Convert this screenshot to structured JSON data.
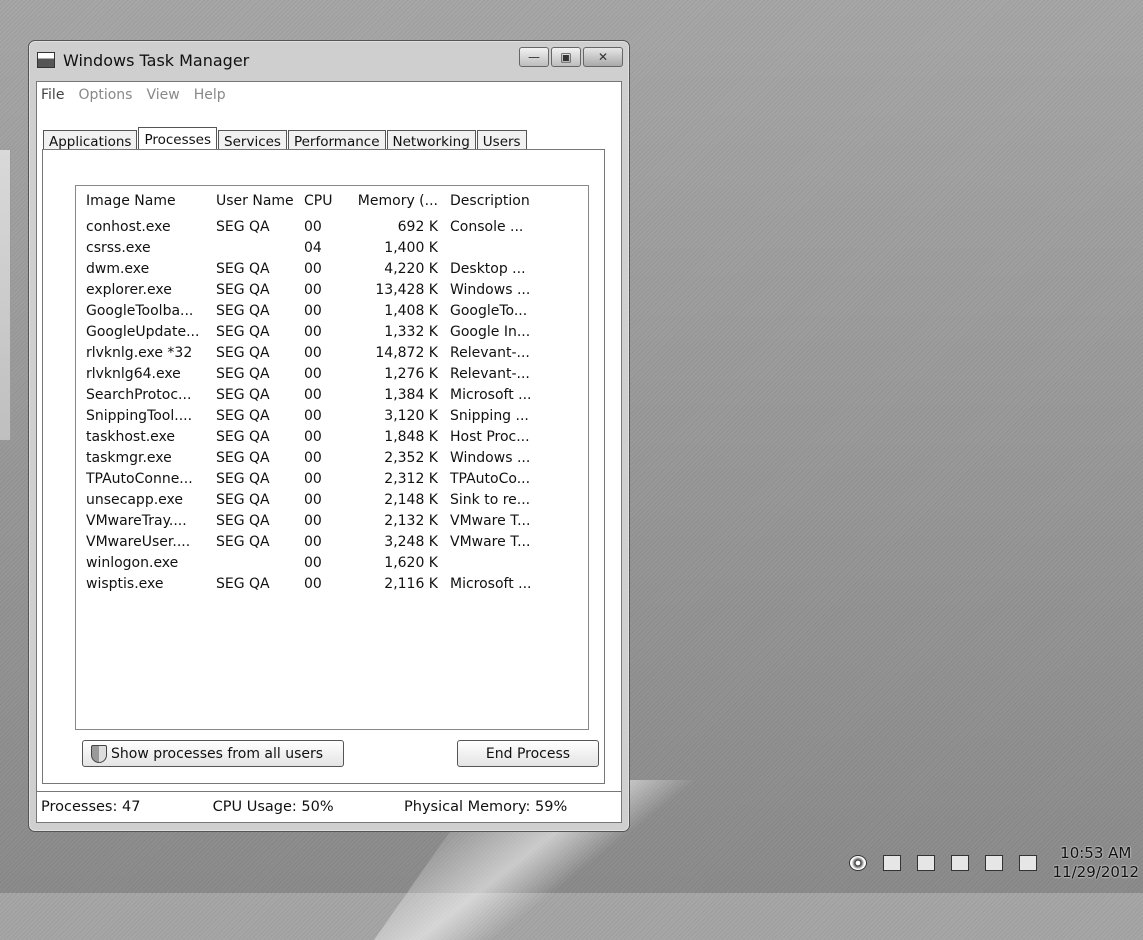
{
  "window": {
    "title": "Windows Task Manager",
    "controls": {
      "minimize": "—",
      "maximize": "▣",
      "close": "✕"
    }
  },
  "menu": [
    {
      "label": "File"
    },
    {
      "label": "Options"
    },
    {
      "label": "View"
    },
    {
      "label": "Help"
    }
  ],
  "tabs": [
    {
      "label": "Applications"
    },
    {
      "label": "Processes",
      "active": true
    },
    {
      "label": "Services"
    },
    {
      "label": "Performance"
    },
    {
      "label": "Networking"
    },
    {
      "label": "Users"
    }
  ],
  "process_list": {
    "columns": {
      "name": "Image Name",
      "user": "User Name",
      "cpu": "CPU",
      "memory": "Memory (...",
      "description": "Description"
    },
    "rows": [
      {
        "name": "conhost.exe",
        "user": "SEG QA",
        "cpu": "00",
        "memory": "692 K",
        "description": "Console ..."
      },
      {
        "name": "csrss.exe",
        "user": "",
        "cpu": "04",
        "memory": "1,400 K",
        "description": ""
      },
      {
        "name": "dwm.exe",
        "user": "SEG QA",
        "cpu": "00",
        "memory": "4,220 K",
        "description": "Desktop ..."
      },
      {
        "name": "explorer.exe",
        "user": "SEG QA",
        "cpu": "00",
        "memory": "13,428 K",
        "description": "Windows ..."
      },
      {
        "name": "GoogleToolba...",
        "user": "SEG QA",
        "cpu": "00",
        "memory": "1,408 K",
        "description": "GoogleTo..."
      },
      {
        "name": "GoogleUpdate...",
        "user": "SEG QA",
        "cpu": "00",
        "memory": "1,332 K",
        "description": "Google In..."
      },
      {
        "name": "rlvknlg.exe *32",
        "user": "SEG QA",
        "cpu": "00",
        "memory": "14,872 K",
        "description": "Relevant-..."
      },
      {
        "name": "rlvknlg64.exe",
        "user": "SEG QA",
        "cpu": "00",
        "memory": "1,276 K",
        "description": "Relevant-..."
      },
      {
        "name": "SearchProtoc...",
        "user": "SEG QA",
        "cpu": "00",
        "memory": "1,384 K",
        "description": "Microsoft ..."
      },
      {
        "name": "SnippingTool....",
        "user": "SEG QA",
        "cpu": "00",
        "memory": "3,120 K",
        "description": "Snipping ..."
      },
      {
        "name": "taskhost.exe",
        "user": "SEG QA",
        "cpu": "00",
        "memory": "1,848 K",
        "description": "Host Proc..."
      },
      {
        "name": "taskmgr.exe",
        "user": "SEG QA",
        "cpu": "00",
        "memory": "2,352 K",
        "description": "Windows ..."
      },
      {
        "name": "TPAutoConne...",
        "user": "SEG QA",
        "cpu": "00",
        "memory": "2,312 K",
        "description": "TPAutoCo..."
      },
      {
        "name": "unsecapp.exe",
        "user": "SEG QA",
        "cpu": "00",
        "memory": "2,148 K",
        "description": "Sink to re..."
      },
      {
        "name": "VMwareTray....",
        "user": "SEG QA",
        "cpu": "00",
        "memory": "2,132 K",
        "description": "VMware T..."
      },
      {
        "name": "VMwareUser....",
        "user": "SEG QA",
        "cpu": "00",
        "memory": "3,248 K",
        "description": "VMware T..."
      },
      {
        "name": "winlogon.exe",
        "user": "",
        "cpu": "00",
        "memory": "1,620 K",
        "description": ""
      },
      {
        "name": "wisptis.exe",
        "user": "SEG QA",
        "cpu": "00",
        "memory": "2,116 K",
        "description": "Microsoft ..."
      }
    ]
  },
  "buttons": {
    "show_all": "Show processes from all users",
    "end_process": "End Process"
  },
  "status": {
    "processes": "Processes: 47",
    "cpu": "CPU Usage: 50%",
    "memory": "Physical Memory: 59%"
  },
  "tray": {
    "time": "10:53 AM",
    "date": "11/29/2012",
    "icons": [
      "globe-icon",
      "action-center-icon",
      "network-icon",
      "display-icon",
      "battery-icon",
      "volume-icon"
    ]
  }
}
